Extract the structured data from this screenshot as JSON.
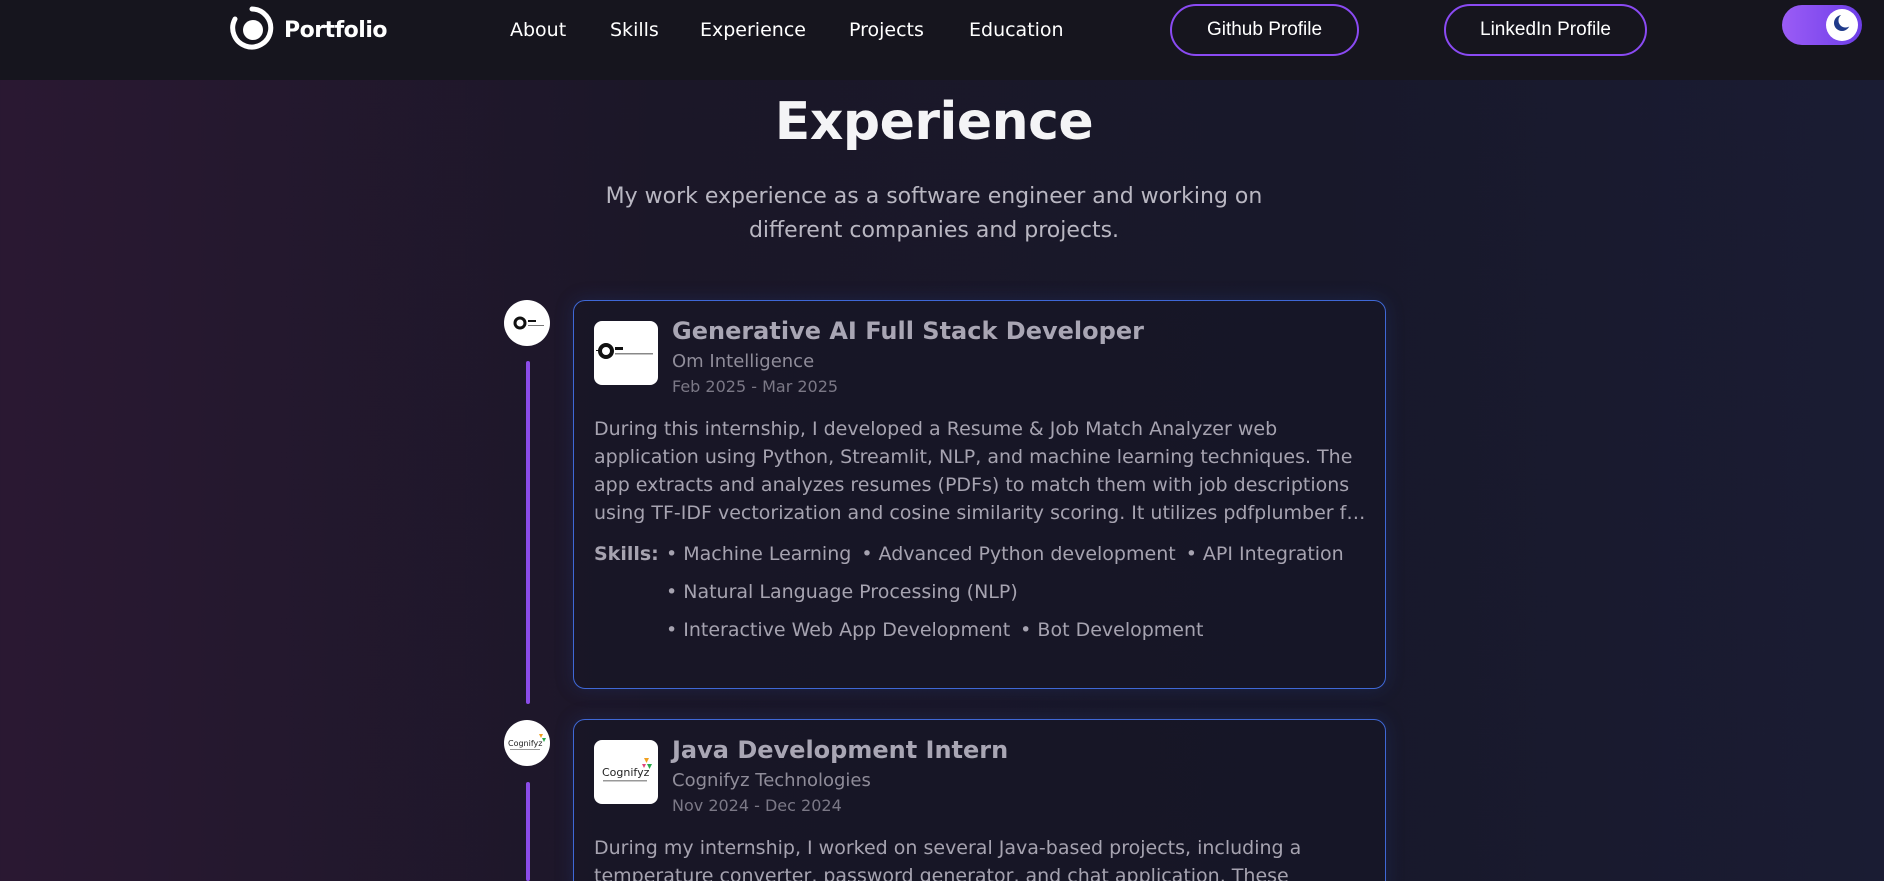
{
  "navbar": {
    "logo_text": "Portfolio",
    "links": [
      {
        "label": "About"
      },
      {
        "label": "Skills"
      },
      {
        "label": "Experience"
      },
      {
        "label": "Projects"
      },
      {
        "label": "Education"
      }
    ],
    "github_label": "Github Profile",
    "linkedin_label": "LinkedIn Profile",
    "theme_icon": "moon-icon",
    "accent_color": "#8a4af3"
  },
  "section": {
    "title": "Experience",
    "subtitle": "My work experience as a software engineer and working on different companies and projects."
  },
  "experiences": [
    {
      "role": "Generative AI Full Stack Developer",
      "company": "Om Intelligence",
      "dates": "Feb 2025 - Mar 2025",
      "description": "During this internship, I developed a Resume & Job Match Analyzer web application using Python, Streamlit, NLP, and machine learning techniques. The app extracts and analyzes resumes (PDFs) to match them with job descriptions using TF-IDF vectorization and cosine similarity scoring. It utilizes pdfplumber for text extraction from uploaded resumes.",
      "skills_label": "Skills:",
      "skills": [
        [
          "• Machine Learning",
          "• Advanced Python development",
          "• API Integration"
        ],
        [
          "• Natural Language Processing (NLP)"
        ],
        [
          "• Interactive Web App Development",
          "• Bot Development"
        ]
      ]
    },
    {
      "role": "Java Development Intern",
      "company": "Cognifyz Technologies",
      "dates": "Nov 2024 - Dec 2024",
      "description": "During my internship, I worked on several Java-based projects, including a temperature converter, password generator, and chat application. These"
    }
  ]
}
